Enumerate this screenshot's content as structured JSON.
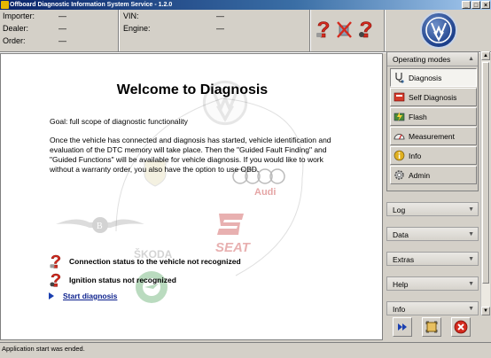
{
  "window": {
    "title": "Offboard Diagnostic Information System Service - 1.2.0"
  },
  "header": {
    "importer_label": "Importer:",
    "importer_value": "—",
    "dealer_label": "Dealer:",
    "dealer_value": "—",
    "order_label": "Order:",
    "order_value": "—",
    "vin_label": "VIN:",
    "vin_value": "—",
    "engine_label": "Engine:",
    "engine_value": "—",
    "status_icons": [
      "vehicle-status-question-icon",
      "connection-crossed-icon",
      "ignition-question-icon"
    ]
  },
  "main": {
    "title": "Welcome to Diagnosis",
    "goal": "Goal: full scope of diagnostic functionality",
    "paragraph": "Once the vehicle has connected and diagnosis has started, vehicle identification and evaluation of the DTC memory will take place. Then the \"Guided Fault Finding\" and \"Guided Functions\" will be available for vehicle diagnosis. If you would like to work without a warranty order, you also have the option to use OBD.",
    "status_connection": "Connection status to the vehicle not recognized",
    "status_ignition": "Ignition status not recognized",
    "start_link": "Start diagnosis",
    "watermark_labels": {
      "audi": "Audi",
      "skoda": "ŠKODA",
      "seat": "SEAT"
    }
  },
  "sidebar": {
    "operating_modes_title": "Operating modes",
    "modes": [
      {
        "label": "Diagnosis",
        "icon": "stethoscope-icon",
        "active": true
      },
      {
        "label": "Self Diagnosis",
        "icon": "self-diagnosis-icon",
        "active": false
      },
      {
        "label": "Flash",
        "icon": "flash-icon",
        "active": false
      },
      {
        "label": "Measurement",
        "icon": "measurement-icon",
        "active": false
      },
      {
        "label": "Info",
        "icon": "info-icon",
        "active": false
      },
      {
        "label": "Admin",
        "icon": "admin-icon",
        "active": false
      }
    ],
    "sections": [
      "Log",
      "Data",
      "Extras",
      "Help",
      "Info"
    ]
  },
  "actions": {
    "next": "fast-forward-icon",
    "screenshot": "capture-icon",
    "exit": "exit-icon"
  },
  "statusbar": {
    "text": "Application start was ended."
  },
  "colors": {
    "title_bar": "#0a246a",
    "link": "#0a1f8c",
    "panel": "#d4d0c8",
    "exit_red": "#d42a1e"
  }
}
